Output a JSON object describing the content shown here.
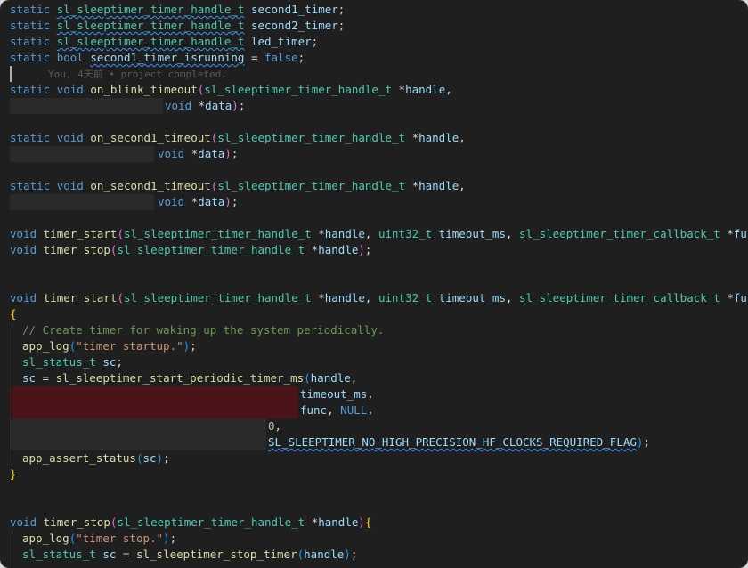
{
  "lines": [
    {
      "t": "static sl_sleeptimer_timer_handle_t second1_timer;"
    },
    {
      "t": "static sl_sleeptimer_timer_handle_t second2_timer;"
    },
    {
      "t": "static sl_sleeptimer_timer_handle_t led_timer;"
    },
    {
      "t": "static bool second1_timer_isrunning = false;"
    },
    {
      "blame": "You, 4天前 • project completed."
    },
    {
      "t": "static void on_blink_timeout(sl_sleeptimer_timer_handle_t *handle,"
    },
    {
      "t": "void *data);"
    },
    {
      "t": "static void on_second1_timeout(sl_sleeptimer_timer_handle_t *handle,"
    },
    {
      "t": "void *data);"
    },
    {
      "t": "void timer_start(sl_sleeptimer_timer_handle_t *handle, uint32_t timeout_ms, sl_sleeptimer_timer_callback_t *func);"
    },
    {
      "t": "void timer_stop(sl_sleeptimer_timer_handle_t *handle);"
    },
    {
      "t": "// Create timer for waking up the system periodically."
    },
    {
      "t": "app_log(\"timer startup.\");"
    },
    {
      "t": "app_log(\"timer stop.\");"
    }
  ],
  "tokens": {
    "static": "static",
    "void": "void",
    "bool": "bool",
    "false": "false",
    "handle_type": "sl_sleeptimer_timer_handle_t",
    "second1_timer": "second1_timer",
    "second2_timer": "second2_timer",
    "led_timer": "led_timer",
    "second1_timer_isrunning": "second1_timer_isrunning",
    "on_blink_timeout": "on_blink_timeout",
    "on_second1_timeout": "on_second1_timeout",
    "handle": "handle",
    "data": "data",
    "timer_start": "timer_start",
    "timer_stop": "timer_stop",
    "uint32_t": "uint32_t",
    "timeout_ms": "timeout_ms",
    "callback_type": "sl_sleeptimer_timer_callback_t",
    "func": "func",
    "comment": "// Create timer for waking up the system periodically.",
    "app_log": "app_log",
    "str_startup": "\"timer startup.\"",
    "str_stop": "\"timer stop.\"",
    "sl_status_t": "sl_status_t",
    "sc": "sc",
    "start_periodic": "sl_sleeptimer_start_periodic_timer_ms",
    "NULL": "NULL",
    "zero": "0",
    "flag": "SL_SLEEPTIMER_NO_HIGH_PRECISION_HF_CLOCKS_REQUIRED_FLAG",
    "app_assert_status": "app_assert_status",
    "stop_timer": "sl_sleeptimer_stop_timer",
    "blame": "You, 4天前 • project completed."
  }
}
